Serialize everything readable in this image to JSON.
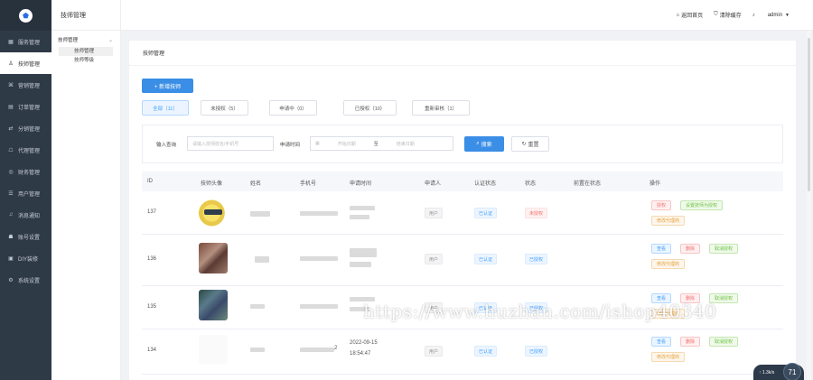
{
  "sidebar": {
    "items": [
      {
        "label": "服务管理",
        "icon": "grid-icon"
      },
      {
        "label": "技师管理",
        "icon": "user-icon",
        "active": true
      },
      {
        "label": "营销管理",
        "icon": "tag-icon"
      },
      {
        "label": "订单管理",
        "icon": "order-icon"
      },
      {
        "label": "分销管理",
        "icon": "share-icon"
      },
      {
        "label": "代理管理",
        "icon": "agent-icon"
      },
      {
        "label": "财务管理",
        "icon": "finance-icon"
      },
      {
        "label": "用户管理",
        "icon": "users-icon"
      },
      {
        "label": "消息通知",
        "icon": "bell-icon"
      },
      {
        "label": "账号设置",
        "icon": "account-icon"
      },
      {
        "label": "DIY装修",
        "icon": "diy-icon"
      },
      {
        "label": "系统设置",
        "icon": "gear-icon"
      }
    ]
  },
  "subsidebar": {
    "title": "技师管理",
    "group": "技师管理",
    "items": [
      {
        "label": "技师管理",
        "active": true
      },
      {
        "label": "技师等级"
      }
    ]
  },
  "topbar": {
    "home": "返回首页",
    "clear_cache": "清除缓存",
    "user": "admin"
  },
  "breadcrumb": "技师管理",
  "add_button": "+ 新增技师",
  "tabs": [
    {
      "label": "全部（11）",
      "active": true
    },
    {
      "label": "未授权（5）"
    },
    {
      "label": "申请中（0）"
    },
    {
      "label": "已授权（10）"
    },
    {
      "label": "重新审核（1）"
    }
  ],
  "filter": {
    "query_label": "输入查询",
    "query_placeholder": "请输入技师姓名/手机号",
    "time_label": "申请时间",
    "start_placeholder": "开始日期",
    "range_sep": "至",
    "end_placeholder": "结束日期",
    "search_button": "搜索",
    "reset_button": "重置"
  },
  "table": {
    "headers": [
      "ID",
      "技师头像",
      "姓名",
      "手机号",
      "申请时间",
      "申请人",
      "认证状态",
      "状态",
      "前置在状态",
      "操作"
    ],
    "rows": [
      {
        "id": "137",
        "applicant": "用户",
        "auth": "已认证",
        "status": "未授权",
        "ops": [
          "授权",
          "设置技师为授权",
          "修改代理商"
        ]
      },
      {
        "id": "136",
        "applicant": "用户",
        "auth": "已认证",
        "status": "已授权",
        "ops": [
          "查看",
          "删除",
          "取消授权",
          "修改代理商"
        ]
      },
      {
        "id": "135",
        "applicant": "用户",
        "auth": "已认证",
        "status": "已授权",
        "ops": [
          "查看",
          "删除",
          "取消授权",
          "修改代理商"
        ]
      },
      {
        "id": "134",
        "date": "2022-09-15",
        "time": "18:54:47",
        "phone_frag": "2",
        "applicant": "用户",
        "auth": "已认证",
        "status": "已授权",
        "ops": [
          "查看",
          "删除",
          "取消授权",
          "修改代理商"
        ]
      }
    ]
  },
  "watermark": "https://www.huzhan.com/ishop40340",
  "speed_widget": {
    "rate": "↑ 1.3k/s",
    "value": "71"
  }
}
